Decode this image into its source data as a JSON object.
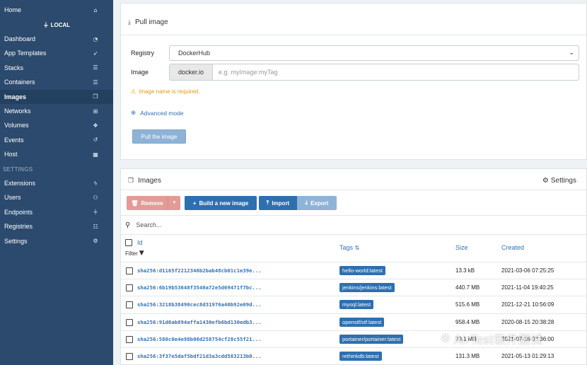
{
  "sidebar": {
    "top_items": [
      {
        "label": "Home",
        "icon": "home-icon",
        "glyph": "⌂"
      }
    ],
    "env_header": "LOCAL",
    "env_items": [
      {
        "label": "Dashboard",
        "icon": "dashboard-icon",
        "glyph": "◔"
      },
      {
        "label": "App Templates",
        "icon": "rocket-icon",
        "glyph": "➶"
      },
      {
        "label": "Stacks",
        "icon": "list-icon",
        "glyph": "☰"
      },
      {
        "label": "Containers",
        "icon": "server-icon",
        "glyph": "☰"
      },
      {
        "label": "Images",
        "icon": "clone-icon",
        "glyph": "❐"
      },
      {
        "label": "Networks",
        "icon": "sitemap-icon",
        "glyph": "⊞"
      },
      {
        "label": "Volumes",
        "icon": "cubes-icon",
        "glyph": "❖"
      },
      {
        "label": "Events",
        "icon": "history-icon",
        "glyph": "↺"
      },
      {
        "label": "Host",
        "icon": "grid-icon",
        "glyph": "▦"
      }
    ],
    "settings_header": "SETTINGS",
    "settings_items": [
      {
        "label": "Extensions",
        "icon": "bolt-icon",
        "glyph": "ϟ"
      },
      {
        "label": "Users",
        "icon": "users-icon",
        "glyph": "⚇"
      },
      {
        "label": "Endpoints",
        "icon": "plug-icon",
        "glyph": "⏚"
      },
      {
        "label": "Registries",
        "icon": "database-icon",
        "glyph": "☷"
      },
      {
        "label": "Settings",
        "icon": "cogs-icon",
        "glyph": "⚙"
      }
    ]
  },
  "pull": {
    "title": "Pull image",
    "registry_label": "Registry",
    "registry_value": "DockerHub",
    "image_label": "Image",
    "registry_prefix": "docker.io",
    "image_placeholder": "e.g. myImage:myTag",
    "warning": "Image name is required.",
    "advanced_mode": "Advanced mode",
    "pull_button": "Pull the image"
  },
  "images": {
    "title": "Images",
    "settings_label": "Settings",
    "buttons": {
      "remove": "Remove",
      "build": "Build a new image",
      "import": "Import",
      "export": "Export"
    },
    "search_placeholder": "Search...",
    "columns": {
      "id": "Id",
      "filter": "Filter",
      "tags": "Tags",
      "size": "Size",
      "created": "Created"
    },
    "rows": [
      {
        "id": "sha256:d1165f2212346b2bab48cb01c1e39e...",
        "tag": "hello-world:latest",
        "size": "13.3 kB",
        "created": "2021-03-06 07:25:25"
      },
      {
        "id": "sha256:6b19b53648f3540a72e5d69471f7bc...",
        "tag": "jenkins/jenkins:latest",
        "size": "440.7 MB",
        "created": "2021-11-04 19:40:25"
      },
      {
        "id": "sha256:3218b38490cec8d31976a40b92e09d...",
        "tag": "mysql:latest",
        "size": "515.6 MB",
        "created": "2021-12-21 10:56:09"
      },
      {
        "id": "sha256:91d0ab894affa1430efb6bd130edb3...",
        "tag": "openstf/stf:latest",
        "size": "958.4 MB",
        "created": "2020-08-15 20:38:28"
      },
      {
        "id": "sha256:580c0e4e98b06d258754cf28c55f21...",
        "tag": "portainer/portainer:latest",
        "size": "79.1 MB",
        "created": "2021-07-16 07:36:00"
      },
      {
        "id": "sha256:3f37e5daf5bdf21d3a3cdd583213b0...",
        "tag": "rethinkdb:latest",
        "size": "131.3 MB",
        "created": "2021-05-13 01:29:13"
      }
    ]
  },
  "watermark": "AirTest软件测试"
}
